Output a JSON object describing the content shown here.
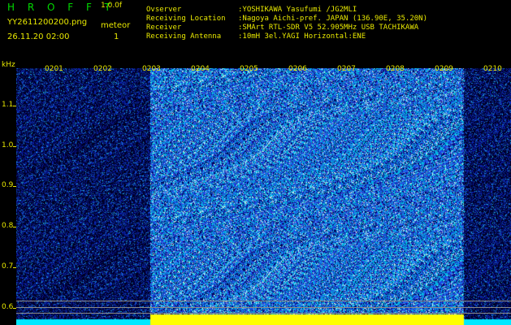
{
  "header": {
    "app_title": "H R O F F T",
    "version": "1.0.0f",
    "filename": "YY2611200200.png",
    "meteor_label": "meteor",
    "datetime": "26.11.20 02:00",
    "meteor_count": "1"
  },
  "station": [
    {
      "key": "Ovserver",
      "value": ":YOSHIKAWA Yasufumi /JG2MLI"
    },
    {
      "key": "Receiving Location",
      "value": ":Nagoya Aichi-pref. JAPAN (136.90E, 35.20N)"
    },
    {
      "key": "Receiver",
      "value": ":SMArt RTL-SDR V5 52.905MHz USB TACHIKAWA"
    },
    {
      "key": "Receiving Antenna",
      "value": ":10mH 3el.YAGI Horizontal:ENE"
    }
  ],
  "spectrogram": {
    "unit": "kHz",
    "freq_ticks": [
      "1.1",
      "1.0",
      "0.9",
      "0.8",
      "0.7",
      "0.6"
    ],
    "minute_labels": [
      "0201",
      "0202",
      "0203",
      "0204",
      "0205",
      "0206",
      "0207",
      "0208",
      "0209",
      "0210"
    ],
    "colors": {
      "background": "#000000",
      "text": "#e8e800",
      "noise_low": "#1a3ac8",
      "noise_high": "#00e8e8",
      "marker": "#ffff00"
    }
  }
}
